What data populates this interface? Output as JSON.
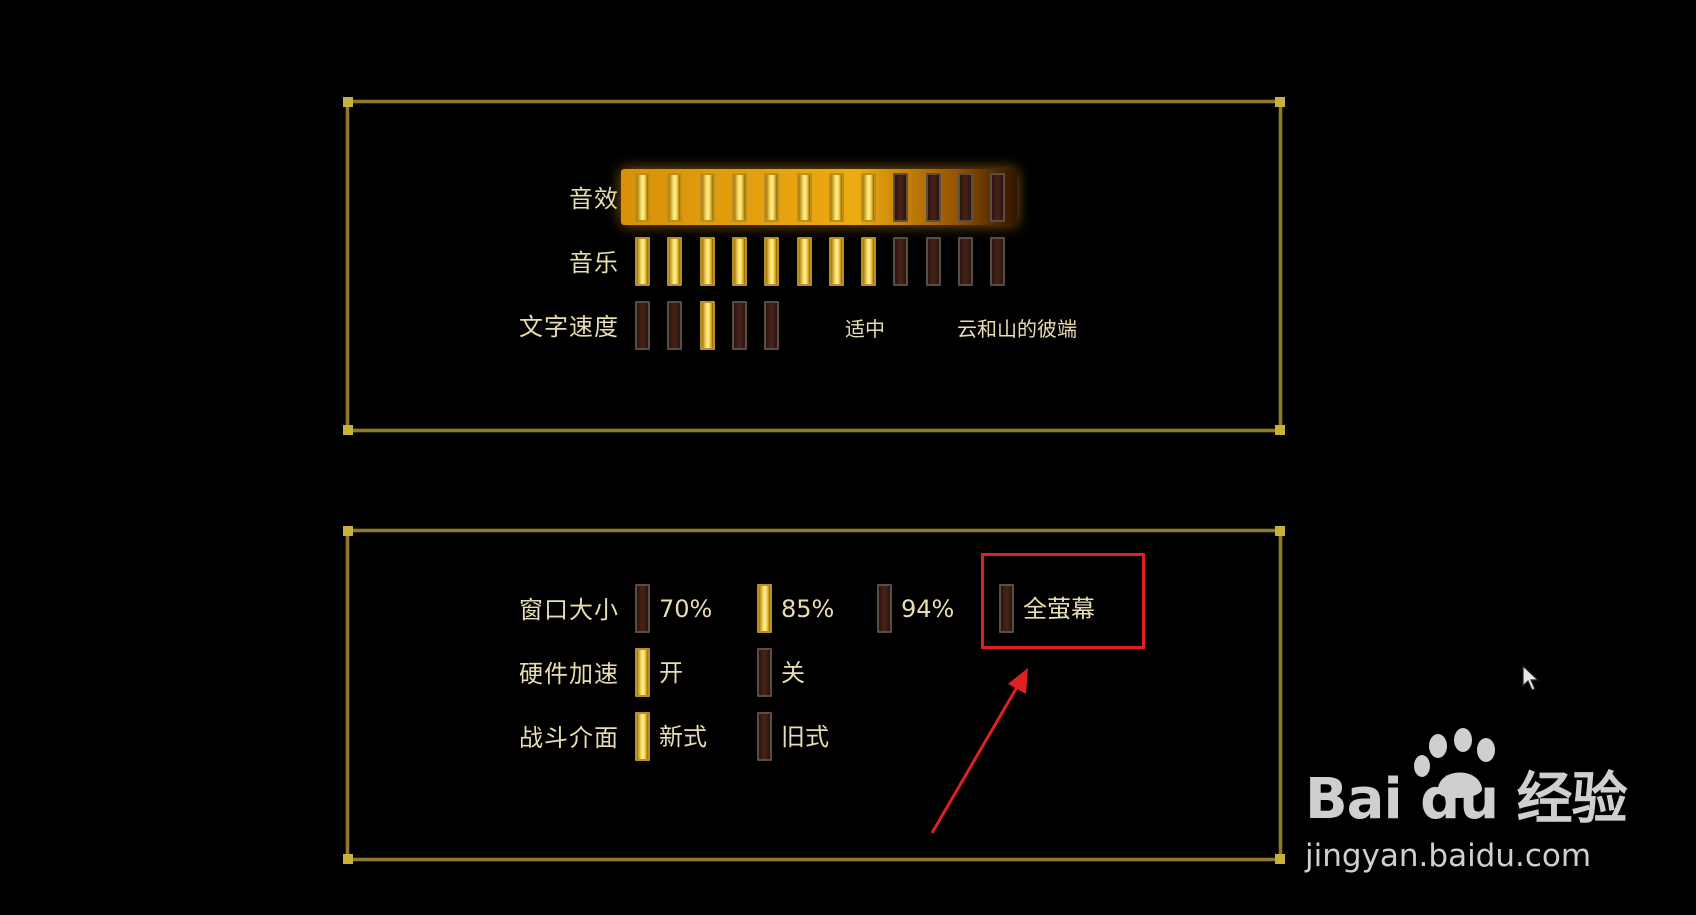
{
  "audio_panel": {
    "sound_effects": {
      "label": "音效",
      "level": 8,
      "max": 12
    },
    "music": {
      "label": "音乐",
      "level": 8,
      "max": 12
    },
    "text_speed": {
      "label": "文字速度",
      "selected_index": 2,
      "count": 5,
      "value_text": "适中",
      "sample_text": "云和山的彼端"
    }
  },
  "display_panel": {
    "window_size": {
      "label": "窗口大小",
      "options": [
        "70%",
        "85%",
        "94%",
        "全萤幕"
      ],
      "selected": "85%"
    },
    "hardware_accel": {
      "label": "硬件加速",
      "options": [
        "开",
        "关"
      ],
      "selected": "开"
    },
    "battle_ui": {
      "label": "战斗介面",
      "options": [
        "新式",
        "旧式"
      ],
      "selected": "新式"
    }
  },
  "annotation": {
    "highlight_target": "全萤幕",
    "color": "#e02020"
  },
  "watermark": {
    "brand": "Bai du 经验",
    "site": "jingyan.baidu.com"
  },
  "colors": {
    "frame": "#8a7a2a",
    "text": "#e8dcb4",
    "pip_on": "#f5d65a",
    "pip_off": "#4a2418"
  }
}
